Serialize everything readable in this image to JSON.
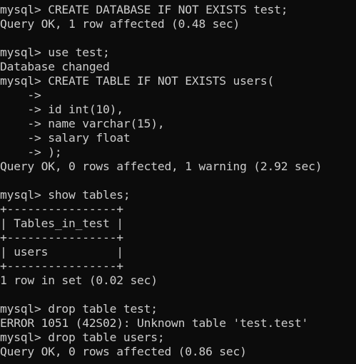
{
  "window": {
    "background": "#0c0c0c",
    "foreground": "#cccccc"
  },
  "lines": [
    "mysql> CREATE DATABASE IF NOT EXISTS test;",
    "Query OK, 1 row affected (0.48 sec)",
    "",
    "mysql> use test;",
    "Database changed",
    "mysql> CREATE TABLE IF NOT EXISTS users(",
    "    ->",
    "    -> id int(10),",
    "    -> name varchar(15),",
    "    -> salary float",
    "    -> );",
    "Query OK, 0 rows affected, 1 warning (2.92 sec)",
    "",
    "mysql> show tables;",
    "+----------------+",
    "| Tables_in_test |",
    "+----------------+",
    "| users          |",
    "+----------------+",
    "1 row in set (0.02 sec)",
    "",
    "mysql> drop table test;",
    "ERROR 1051 (42S02): Unknown table 'test.test'",
    "mysql> drop table users;",
    "Query OK, 0 rows affected (0.86 sec)"
  ]
}
